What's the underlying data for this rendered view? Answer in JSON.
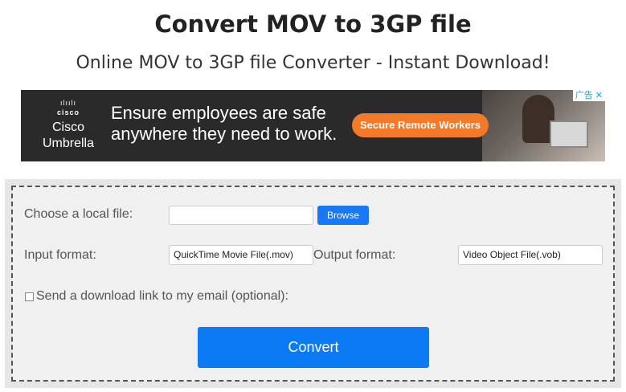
{
  "page": {
    "title": "Convert MOV to 3GP file",
    "subtitle": "Online MOV to 3GP file Converter - Instant Download!"
  },
  "ad": {
    "brand_logo_text": "cisco",
    "brand_name_line1": "Cisco",
    "brand_name_line2": "Umbrella",
    "headline_line1": "Ensure employees are safe",
    "headline_line2": "anywhere they need to work.",
    "cta_label": "Secure Remote Workers",
    "badge": "广告 ✕",
    "colors": {
      "background": "#2a2a2a",
      "cta": "#f37a2a"
    }
  },
  "form": {
    "local_file_label": "Choose a local file:",
    "local_file_value": "",
    "browse_label": "Browse",
    "input_format_label": "Input format:",
    "input_format_value": "QuickTime Movie File(.mov)",
    "output_format_label": "Output format:",
    "output_format_value": "Video Object File(.vob)",
    "email_checkbox_label": "Send a download link to my email (optional):",
    "email_checkbox_checked": false,
    "convert_label": "Convert",
    "colors": {
      "primary_button": "#0d7af5",
      "browse_button": "#1877f2"
    }
  }
}
